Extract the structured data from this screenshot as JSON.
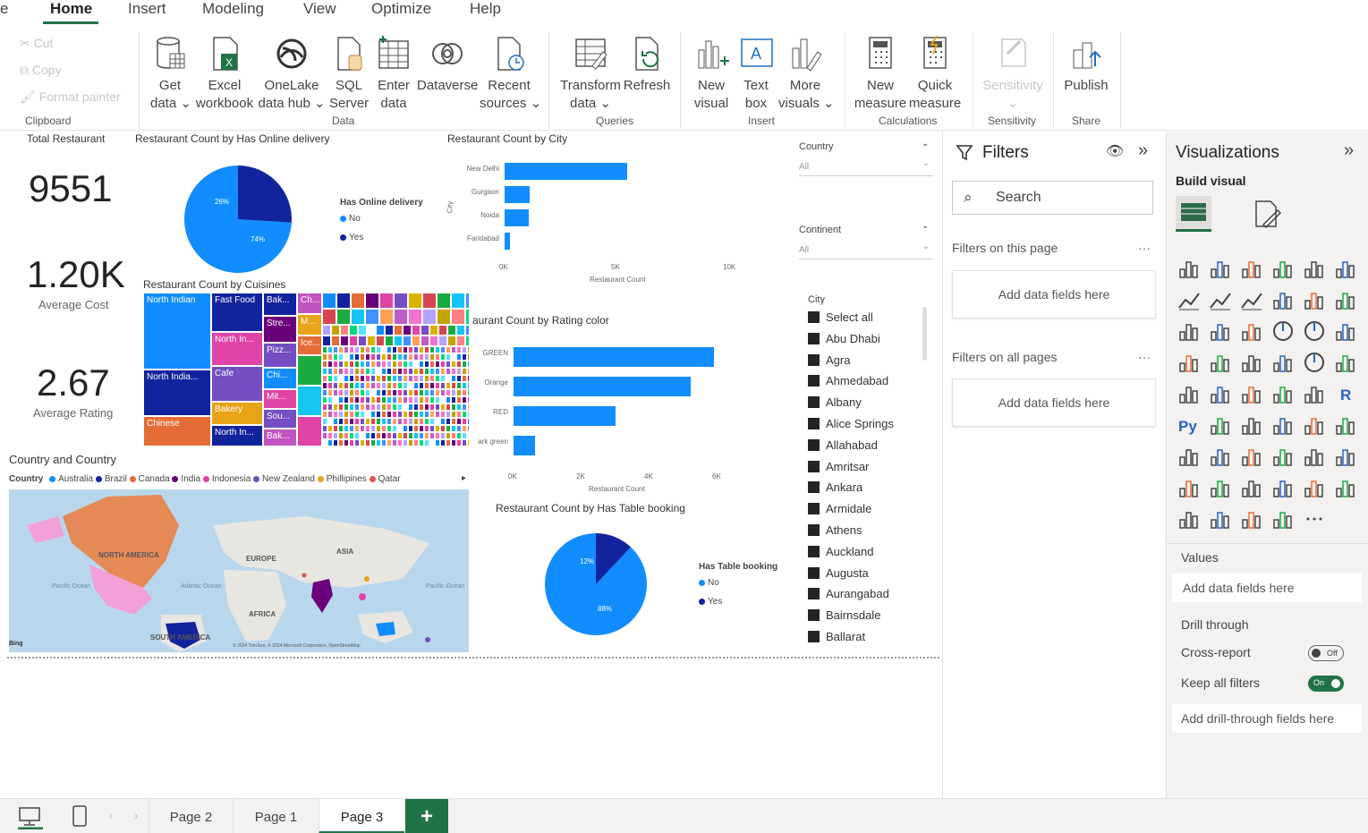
{
  "menu": {
    "cut_off": "e",
    "items": [
      "Home",
      "Insert",
      "Modeling",
      "View",
      "Optimize",
      "Help"
    ]
  },
  "ribbon": {
    "clipboard": {
      "cut": "Cut",
      "copy": "Copy",
      "format_painter": "Format painter",
      "group": "Clipboard"
    },
    "data": {
      "get_data": [
        "Get",
        "data ⌄"
      ],
      "excel": [
        "Excel",
        "workbook"
      ],
      "onelake": [
        "OneLake",
        "data hub ⌄"
      ],
      "sql": [
        "SQL",
        "Server"
      ],
      "enter": [
        "Enter",
        "data"
      ],
      "dataverse": [
        "Dataverse",
        ""
      ],
      "recent": [
        "Recent",
        "sources ⌄"
      ],
      "group": "Data"
    },
    "queries": {
      "transform": [
        "Transform",
        "data ⌄"
      ],
      "refresh": [
        "Refresh",
        ""
      ],
      "group": "Queries"
    },
    "insert": {
      "new_visual": [
        "New",
        "visual"
      ],
      "text_box": [
        "Text",
        "box"
      ],
      "more_visuals": [
        "More",
        "visuals ⌄"
      ],
      "group": "Insert"
    },
    "calculations": {
      "new_measure": [
        "New",
        "measure"
      ],
      "quick_measure": [
        "Quick",
        "measure"
      ],
      "group": "Calculations"
    },
    "sensitivity": {
      "label": "Sensitivity",
      "chev": "⌄",
      "group": "Sensitivity"
    },
    "share": {
      "publish": "Publish",
      "group": "Share"
    }
  },
  "cards": {
    "title": "Total Restaurant",
    "total": "9551",
    "cost": "1.20K",
    "cost_label": "Average Cost",
    "rating": "2.67",
    "rating_label": "Average Rating"
  },
  "online_pie": {
    "title": "Restaurant Count by Has Online delivery",
    "legend_title": "Has Online delivery",
    "legend": [
      "No",
      "Yes"
    ],
    "labels": [
      "26%",
      "74%"
    ]
  },
  "city_chart": {
    "title": "Restaurant Count by City",
    "axis_title": "City",
    "xlabel": "Restaurant Count"
  },
  "treemap": {
    "title": "Restaurant Count by Cuisines",
    "tiles": [
      "North Indian",
      "Fast Food",
      "Bak...",
      "Ch...",
      "M...",
      "North In...",
      "Stre...",
      "Ice...",
      "Pizz...",
      "North India...",
      "Cafe",
      "Chi...",
      "Mit...",
      "Bakery",
      "Sou...",
      "Chinese",
      "North In...",
      "Bak..."
    ]
  },
  "rating_chart": {
    "title": "aurant Count by Rating color",
    "xlabel": "Restaurant Count"
  },
  "map": {
    "title": "Country and Country",
    "legend_label": "Country",
    "legend": [
      "Australia",
      "Brazil",
      "Canada",
      "India",
      "Indonesia",
      "New Zealand",
      "Phillipines",
      "Qatar"
    ],
    "legend_more": "▸",
    "labels": {
      "na": "NORTH AMERICA",
      "eu": "EUROPE",
      "asia": "ASIA",
      "africa": "AFRICA",
      "sa": "SOUTH AMERICA",
      "pac1": "Pacific Ocean",
      "atl": "Atlantic Ocean",
      "pac2": "Pacific Ocean"
    },
    "copyright": "© 2024 TomTom, © 2024 Microsoft Corporation, OpenStreetMap",
    "brand": "Bing"
  },
  "table_pie": {
    "title": "Restaurant Count by Has Table booking",
    "legend_title": "Has Table booking",
    "legend": [
      "No",
      "Yes"
    ],
    "labels": [
      "12%",
      "88%"
    ]
  },
  "slicers": {
    "country": "Country",
    "country_val": "All",
    "continent": "Continent",
    "continent_val": "All",
    "city": "City",
    "cities": [
      "Select all",
      "Abu Dhabi",
      "Agra",
      "Ahmedabad",
      "Albany",
      "Alice Springs",
      "Allahabad",
      "Amritsar",
      "Ankara",
      "Armidale",
      "Athens",
      "Auckland",
      "Augusta",
      "Aurangabad",
      "Bairnsdale",
      "Ballarat"
    ]
  },
  "filters": {
    "title": "Filters",
    "search": "Search",
    "on_page": "Filters on this page",
    "on_all": "Filters on all pages",
    "add": "Add data fields here",
    "more": "···"
  },
  "viz": {
    "title": "Visualizations",
    "build": "Build visual",
    "values": "Values",
    "values_add": "Add data fields here",
    "drill": "Drill through",
    "cross": "Cross-report",
    "cross_state": "Off",
    "keep": "Keep all filters",
    "keep_state": "On",
    "drill_add": "Add drill-through fields here"
  },
  "tabs": {
    "pages": [
      "Page 2",
      "Page 1",
      "Page 3"
    ],
    "add": "+"
  },
  "chart_data": [
    {
      "type": "pie",
      "title": "Restaurant Count by Has Online delivery",
      "categories": [
        "No",
        "Yes"
      ],
      "values": [
        74,
        26
      ],
      "labels": [
        "74%",
        "26%"
      ]
    },
    {
      "type": "bar",
      "title": "Restaurant Count by City",
      "categories": [
        "New Delhi",
        "Gurgaon",
        "Noida",
        "Faridabad"
      ],
      "values": [
        5473,
        1118,
        1080,
        251
      ],
      "xlabel": "Restaurant Count",
      "ylabel": "City",
      "xticks": [
        "0K",
        "5K",
        "10K"
      ],
      "xlim": [
        0,
        10000
      ]
    },
    {
      "type": "bar",
      "title": "Restaurant Count by Rating color",
      "categories": [
        "GREEN",
        "Orange",
        "RED",
        "ark green"
      ],
      "values": [
        5900,
        5200,
        3000,
        630
      ],
      "xlabel": "Restaurant Count",
      "xticks": [
        "0K",
        "2K",
        "4K",
        "6K"
      ],
      "xlim": [
        0,
        6000
      ]
    },
    {
      "type": "pie",
      "title": "Restaurant Count by Has Table booking",
      "categories": [
        "No",
        "Yes"
      ],
      "values": [
        88,
        12
      ],
      "labels": [
        "88%",
        "12%"
      ]
    }
  ],
  "colors": {
    "primary": "#118dff",
    "dark": "#12239e",
    "accent": "#217346"
  }
}
